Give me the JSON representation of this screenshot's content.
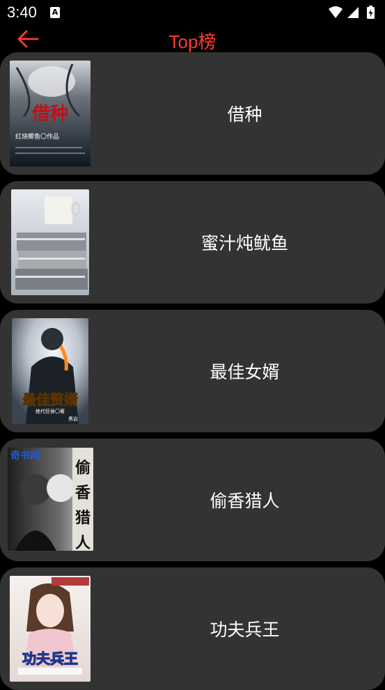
{
  "status_bar": {
    "time": "3:40",
    "notification_glyph": "A",
    "icons": [
      "wifi-icon",
      "signal-icon",
      "battery-charging-icon"
    ]
  },
  "header": {
    "back_icon": "arrow-left-icon",
    "title": "Top榜",
    "accent_color": "#ff3b30"
  },
  "books": [
    {
      "title": "借种",
      "cover_text": "借种",
      "cover_author": "红烧鲫鱼〇作品"
    },
    {
      "title": "蜜汁炖鱿鱼",
      "cover_text": "",
      "cover_author": ""
    },
    {
      "title": "最佳女婿",
      "cover_text": "最佳赘婿",
      "cover_author": "绝代狂侯〇著",
      "cover_badge": "黑岩"
    },
    {
      "title": "偷香猎人",
      "cover_text": "偷香猎人",
      "cover_author": "",
      "cover_badge": "奇书网"
    },
    {
      "title": "功夫兵王",
      "cover_text": "功夫兵王",
      "cover_author": ""
    }
  ],
  "colors": {
    "background": "#000000",
    "card": "#333333",
    "text": "#ffffff"
  }
}
